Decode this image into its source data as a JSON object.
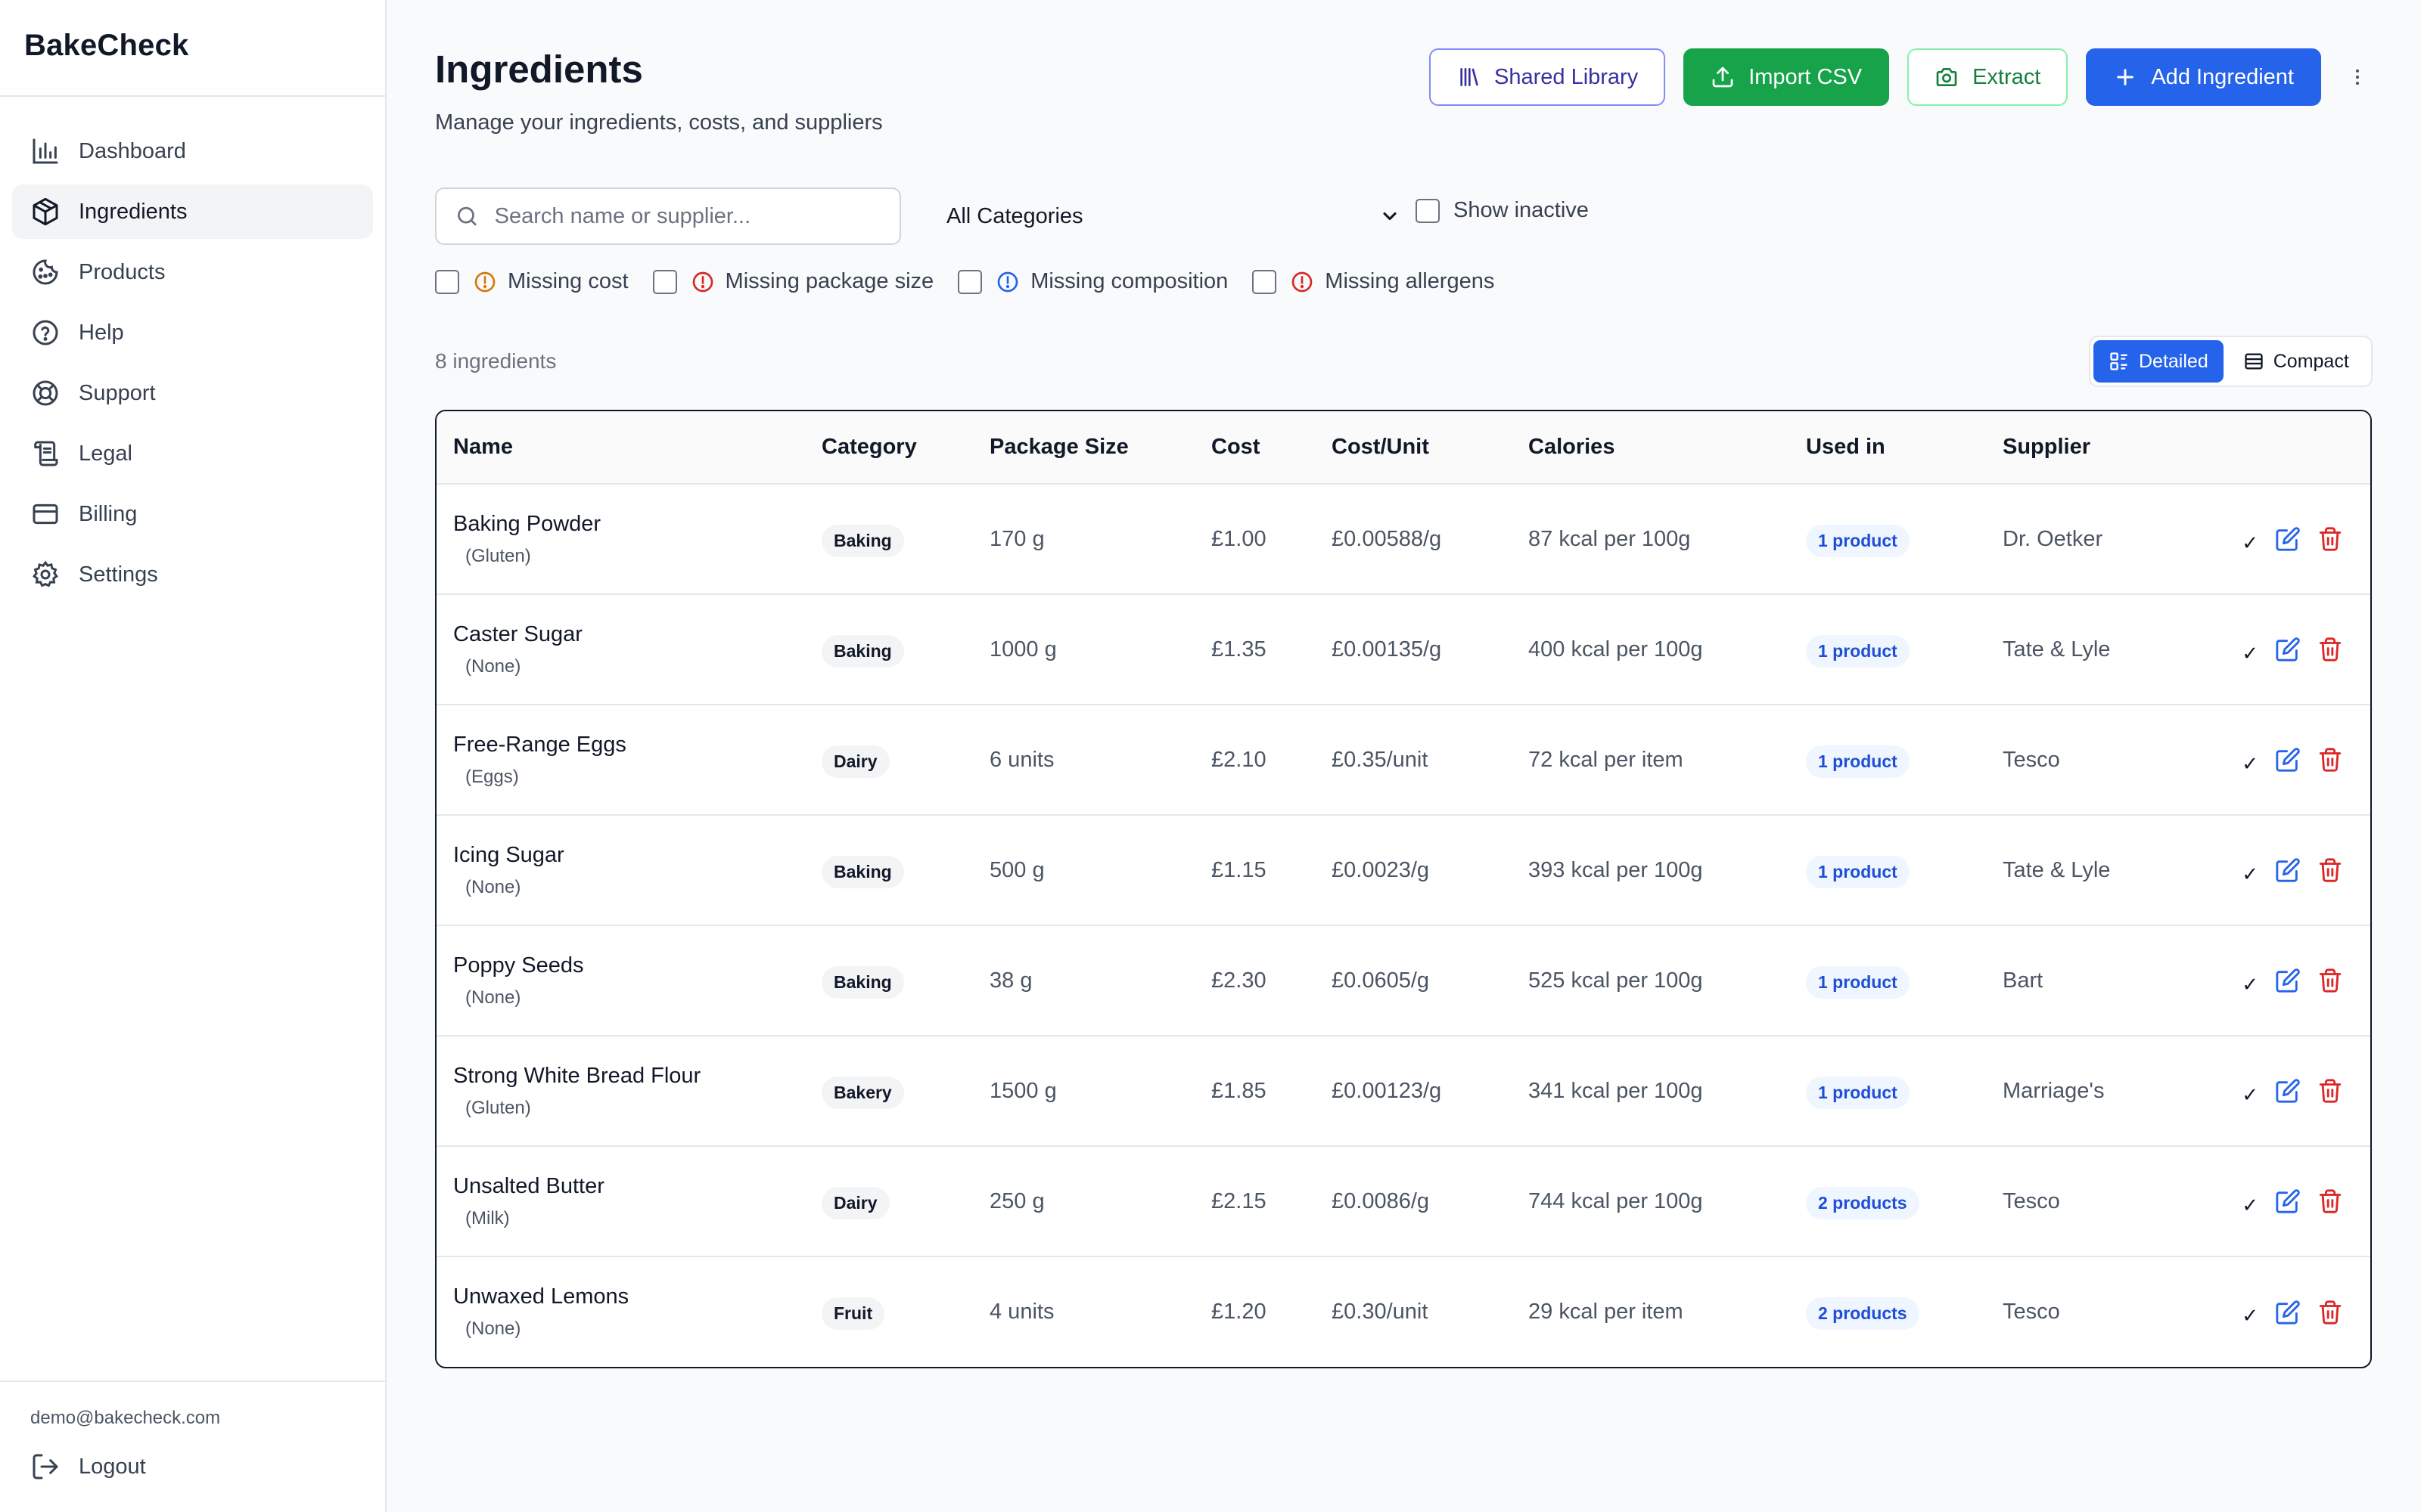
{
  "app": {
    "brand": "BakeCheck"
  },
  "sidebar": {
    "items": [
      {
        "label": "Dashboard",
        "icon": "chart-icon",
        "active": false
      },
      {
        "label": "Ingredients",
        "icon": "package-icon",
        "active": true
      },
      {
        "label": "Products",
        "icon": "cookie-icon",
        "active": false
      },
      {
        "label": "Help",
        "icon": "help-circle-icon",
        "active": false
      },
      {
        "label": "Support",
        "icon": "lifebuoy-icon",
        "active": false
      },
      {
        "label": "Legal",
        "icon": "scroll-icon",
        "active": false
      },
      {
        "label": "Billing",
        "icon": "credit-card-icon",
        "active": false
      },
      {
        "label": "Settings",
        "icon": "gear-icon",
        "active": false
      }
    ],
    "user_email": "demo@bakecheck.com",
    "logout_label": "Logout"
  },
  "header": {
    "title": "Ingredients",
    "subtitle": "Manage your ingredients, costs, and suppliers",
    "actions": {
      "shared_library": "Shared Library",
      "import_csv": "Import CSV",
      "extract": "Extract",
      "add_ingredient": "Add Ingredient"
    }
  },
  "filters": {
    "search_placeholder": "Search name or supplier...",
    "search_value": "",
    "category_selected": "All Categories",
    "show_inactive_label": "Show inactive",
    "flags": [
      {
        "label": "Missing cost",
        "color": "#d97706"
      },
      {
        "label": "Missing package size",
        "color": "#dc2626"
      },
      {
        "label": "Missing composition",
        "color": "#2563eb"
      },
      {
        "label": "Missing allergens",
        "color": "#dc2626"
      }
    ]
  },
  "summary": {
    "count_label": "8 ingredients"
  },
  "view_toggle": {
    "detailed": "Detailed",
    "compact": "Compact",
    "selected": "Detailed"
  },
  "table": {
    "columns": [
      "Name",
      "Category",
      "Package Size",
      "Cost",
      "Cost/Unit",
      "Calories",
      "Used in",
      "Supplier"
    ],
    "rows": [
      {
        "name": "Baking Powder",
        "allergen": "(Gluten)",
        "category": "Baking",
        "package": "170 g",
        "cost": "£1.00",
        "cost_unit": "£0.00588/g",
        "calories": "87 kcal per 100g",
        "used_in": "1 product",
        "supplier": "Dr. Oetker"
      },
      {
        "name": "Caster Sugar",
        "allergen": "(None)",
        "category": "Baking",
        "package": "1000 g",
        "cost": "£1.35",
        "cost_unit": "£0.00135/g",
        "calories": "400 kcal per 100g",
        "used_in": "1 product",
        "supplier": "Tate & Lyle"
      },
      {
        "name": "Free-Range Eggs",
        "allergen": "(Eggs)",
        "category": "Dairy",
        "package": "6 units",
        "cost": "£2.10",
        "cost_unit": "£0.35/unit",
        "calories": "72 kcal per item",
        "used_in": "1 product",
        "supplier": "Tesco"
      },
      {
        "name": "Icing Sugar",
        "allergen": "(None)",
        "category": "Baking",
        "package": "500 g",
        "cost": "£1.15",
        "cost_unit": "£0.0023/g",
        "calories": "393 kcal per 100g",
        "used_in": "1 product",
        "supplier": "Tate & Lyle"
      },
      {
        "name": "Poppy Seeds",
        "allergen": "(None)",
        "category": "Baking",
        "package": "38 g",
        "cost": "£2.30",
        "cost_unit": "£0.0605/g",
        "calories": "525 kcal per 100g",
        "used_in": "1 product",
        "supplier": "Bart"
      },
      {
        "name": "Strong White Bread Flour",
        "allergen": "(Gluten)",
        "category": "Bakery",
        "package": "1500 g",
        "cost": "£1.85",
        "cost_unit": "£0.00123/g",
        "calories": "341 kcal per 100g",
        "used_in": "1 product",
        "supplier": "Marriage's"
      },
      {
        "name": "Unsalted Butter",
        "allergen": "(Milk)",
        "category": "Dairy",
        "package": "250 g",
        "cost": "£2.15",
        "cost_unit": "£0.0086/g",
        "calories": "744 kcal per 100g",
        "used_in": "2 products",
        "supplier": "Tesco"
      },
      {
        "name": "Unwaxed Lemons",
        "allergen": "(None)",
        "category": "Fruit",
        "package": "4 units",
        "cost": "£1.20",
        "cost_unit": "£0.30/unit",
        "calories": "29 kcal per item",
        "used_in": "2 products",
        "supplier": "Tesco"
      }
    ],
    "row_actions": {
      "check_glyph": "✓"
    }
  },
  "colors": {
    "primary": "#2563eb",
    "success": "#16a34a",
    "danger": "#dc2626",
    "indigo": "#4f46e5"
  }
}
